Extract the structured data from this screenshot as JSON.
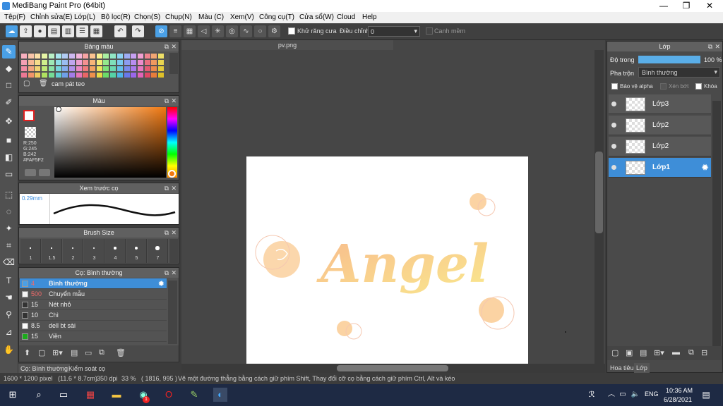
{
  "window": {
    "title": "MediBang Paint Pro (64bit)",
    "min": "—",
    "max": "❐",
    "close": "✕"
  },
  "menu": [
    "Tệp(F)",
    "Chỉnh sửa(E)",
    "Lớp(L)",
    "Bộ lọc(R)",
    "Chọn(S)",
    "Chụp(N)",
    "Màu (C)",
    "Xem(V)",
    "Công cụ(T)",
    "Cửa sổ(W)",
    "Cloud",
    "Help"
  ],
  "toolbar": {
    "antialias_label": "Khử răng cưa",
    "adjust_label": "Điều chỉnh",
    "adjust_value": "0",
    "snap_label": "Canh mềm"
  },
  "colors": {
    "accent": "#4aa0e6",
    "selected_layer": "#3e8ed8",
    "panel": "#535353",
    "taskbar": "#1e2a44"
  },
  "palette_panel": {
    "title": "Bảng màu",
    "palette_name": "cam pát teo"
  },
  "color_panel": {
    "title": "Màu",
    "r": "R:250",
    "g": "G:245",
    "b": "B:242",
    "hex": "#FAF5F2"
  },
  "preview_panel": {
    "title": "Xem trước cọ",
    "size": "0.29mm"
  },
  "brush_size_panel": {
    "title": "Brush Size",
    "sizes": [
      "1",
      "1.5",
      "2",
      "3",
      "4",
      "5",
      "7"
    ]
  },
  "brush_panel": {
    "title": "Cọ: Bình thường",
    "brushes": [
      {
        "num": "4",
        "name": "Bình thường"
      },
      {
        "num": "500",
        "name": "Chuyển mẫu"
      },
      {
        "num": "15",
        "name": "Nét nhỏ"
      },
      {
        "num": "10",
        "name": "Chì"
      },
      {
        "num": "8.5",
        "name": "dell bt sài"
      },
      {
        "num": "15",
        "name": "Viền"
      }
    ]
  },
  "left_tabs": {
    "brush": "Cọ: Bình thường",
    "control": "Kiểm soát cọ"
  },
  "document": {
    "tab": "pv.png",
    "text": "Angel"
  },
  "layer_panel": {
    "title": "Lớp",
    "opacity_label": "Độ trong",
    "opacity_value": "100 %",
    "opacity_fraction": 1.0,
    "blend_label": "Pha trộn",
    "blend_value": "Bình thường",
    "protect_alpha": "Bảo vệ alpha",
    "clipping": "Xén bớt",
    "lock": "Khóa",
    "layers": [
      "Lớp3",
      "Lớp2",
      "Lớp2",
      "Lớp1"
    ],
    "tabs": {
      "nav": "Hoa tiêu",
      "layer": "Lớp"
    }
  },
  "status": {
    "dims": "1600 * 1200 pixel",
    "cm": "(11.6 * 8.7cm)",
    "dpi": "350 dpi",
    "zoom": "33 %",
    "coords": "( 1816, 995 )",
    "hint": "Vẽ một đường thẳng bằng cách giữ phím Shift, Thay đổi cỡ cọ bằng cách giữ phím Ctrl, Alt và kéo"
  },
  "taskbar": {
    "lang": "ENG",
    "time": "10:36 AM",
    "date": "6/28/2021",
    "notif_count": "1"
  }
}
